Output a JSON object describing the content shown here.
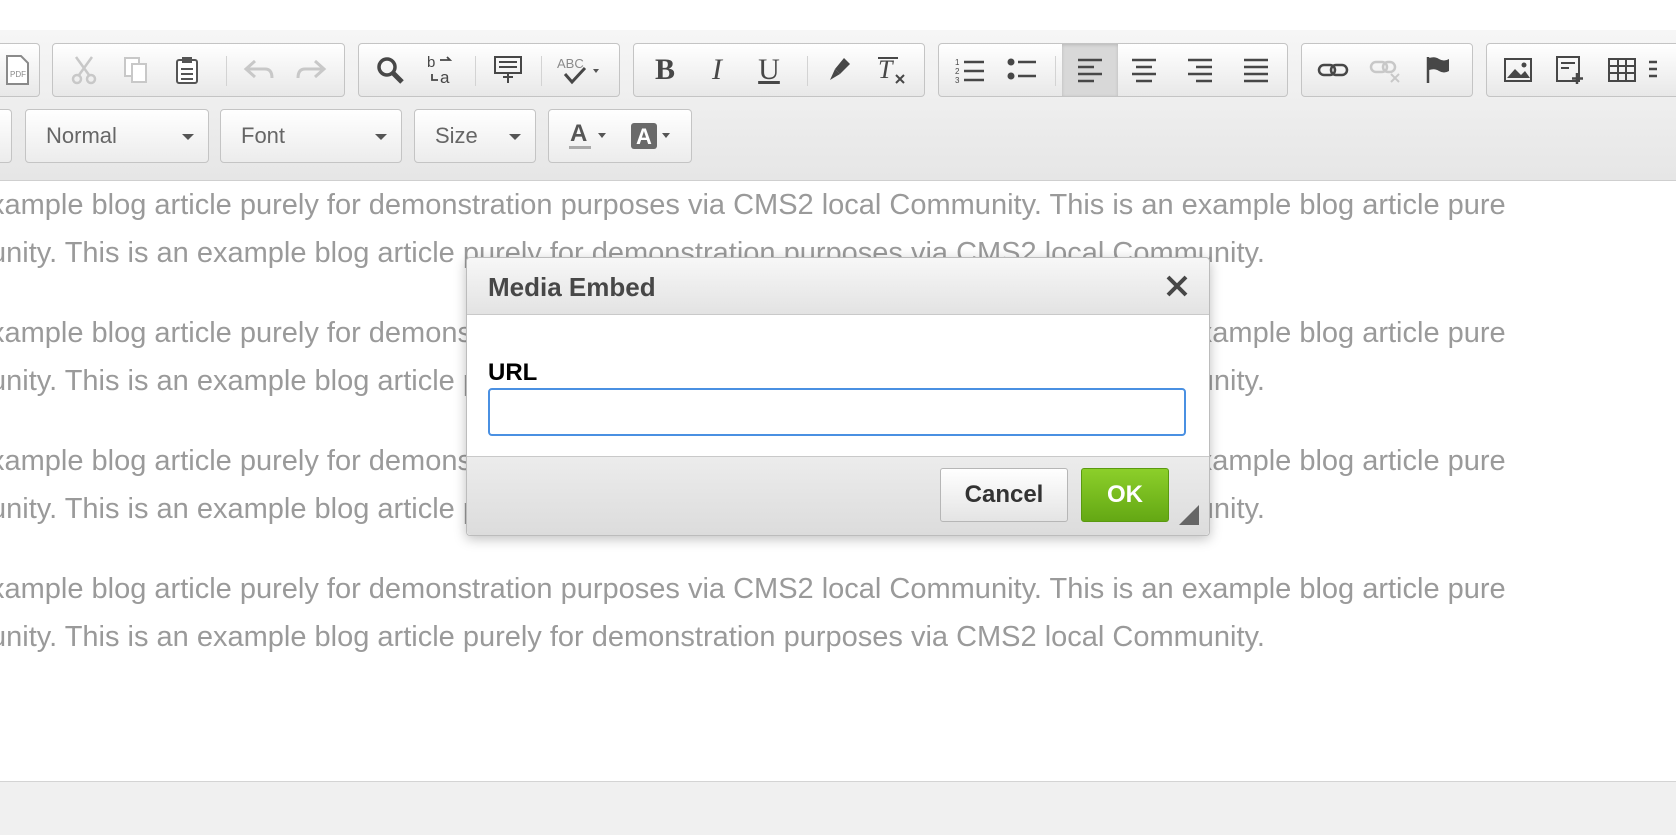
{
  "toolbar": {
    "format_combo": {
      "value": "Normal"
    },
    "font_combo": {
      "value": "Font"
    },
    "size_combo": {
      "value": "Size"
    },
    "icons": [
      "export-pdf-icon",
      "cut-icon",
      "copy-icon",
      "paste-icon",
      "undo-icon",
      "redo-icon",
      "find-icon",
      "replace-icon",
      "select-all-icon",
      "spellcheck-icon",
      "bold-icon",
      "italic-icon",
      "underline-icon",
      "copy-formatting-icon",
      "remove-format-icon",
      "numbered-list-icon",
      "bulleted-list-icon",
      "align-left-icon",
      "align-center-icon",
      "align-right-icon",
      "justify-icon",
      "link-icon",
      "unlink-icon",
      "anchor-icon",
      "image-icon",
      "template-icon",
      "table-icon",
      "text-color-icon",
      "background-color-icon"
    ],
    "active_alignment": "align-left"
  },
  "content": {
    "paragraphs": [
      {
        "line1": "xample blog article purely for demonstration purposes via CMS2 local Community. This is an example blog article pure",
        "line2": "unity. This is an example blog article purely for demonstration purposes via CMS2 local Community."
      },
      {
        "line1": "xample blog article purely for demonstration purposes via CMS2 local Community. This is an example blog article pure",
        "line2": "unity. This is an example blog article purely for demonstration purposes via CMS2 local Community."
      },
      {
        "line1": "xample blog article purely for demonstration purposes via CMS2 local Community. This is an example blog article pure",
        "line2": "unity. This is an example blog article purely for demonstration purposes via CMS2 local Community."
      },
      {
        "line1": "xample blog article purely for demonstration purposes via CMS2 local Community. This is an example blog article pure",
        "line2": "unity. This is an example blog article purely for demonstration purposes via CMS2 local Community."
      }
    ]
  },
  "dialog": {
    "title": "Media Embed",
    "url_label": "URL",
    "url_value": "",
    "cancel_label": "Cancel",
    "ok_label": "OK"
  },
  "colors": {
    "ok_button": "#6ab31b",
    "input_focus": "#4a90e2",
    "content_text": "#9a9a9a"
  }
}
